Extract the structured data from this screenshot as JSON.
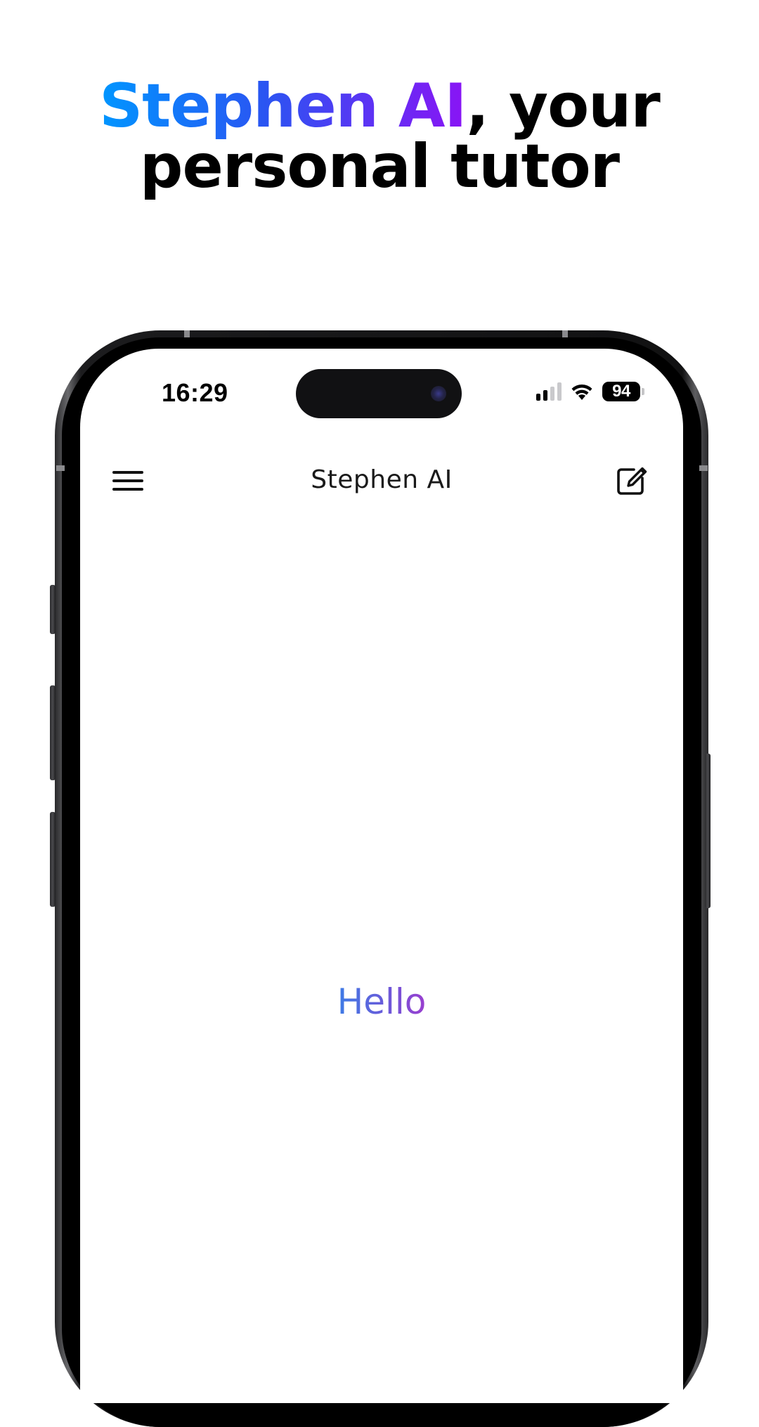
{
  "headline": {
    "brand": "Stephen AI",
    "rest_line1": ", your",
    "line2": "personal tutor"
  },
  "status_bar": {
    "time": "16:29",
    "battery": "94",
    "signal_bars_active": 2,
    "signal_bars_total": 4
  },
  "app_header": {
    "title": "Stephen AI",
    "menu_icon": "hamburger-menu-icon",
    "compose_icon": "compose-icon"
  },
  "main": {
    "greeting": "Hello"
  },
  "colors": {
    "brand_gradient_start": "#0096ff",
    "brand_gradient_end": "#8a14f5",
    "greeting_gradient_start": "#3d7be6",
    "greeting_gradient_end": "#9a3ecf"
  }
}
